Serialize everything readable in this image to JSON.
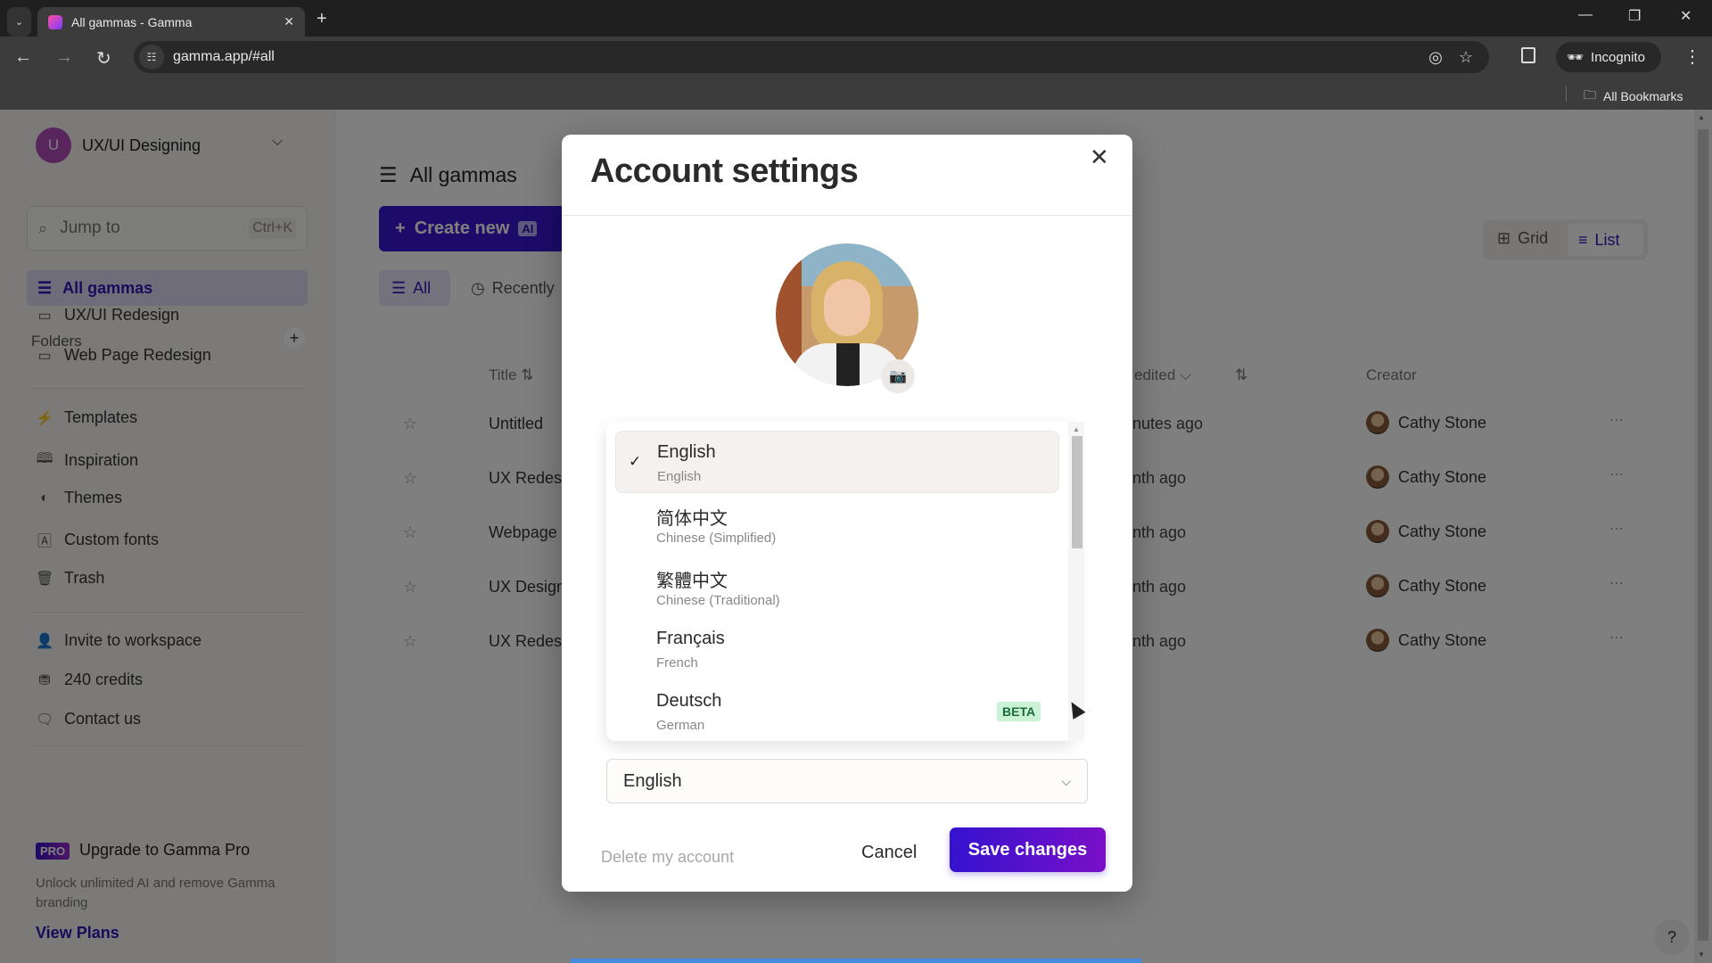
{
  "browser": {
    "tab_title": "All gammas - Gamma",
    "url": "gamma.app/#all",
    "incognito_label": "Incognito",
    "bookmarks_label": "All Bookmarks"
  },
  "sidebar": {
    "workspace_initial": "U",
    "workspace_name": "UX/UI Designing",
    "search_placeholder": "Jump to",
    "search_shortcut": "Ctrl+K",
    "active_item": "All gammas",
    "folders_heading": "Folders",
    "folders": [
      {
        "label": "UX/UI Redesign",
        "icon": "folder-icon"
      },
      {
        "label": "Web Page Redesign",
        "icon": "folder-icon"
      }
    ],
    "items": [
      {
        "label": "Templates",
        "icon": "bolt-icon"
      },
      {
        "label": "Inspiration",
        "icon": "book-icon"
      },
      {
        "label": "Themes",
        "icon": "palette-icon"
      },
      {
        "label": "Custom fonts",
        "icon": "font-icon"
      },
      {
        "label": "Trash",
        "icon": "trash-icon"
      }
    ],
    "bottom_items": [
      {
        "label": "Invite to workspace",
        "icon": "user-plus-icon"
      },
      {
        "label": "240 credits",
        "icon": "coins-icon"
      },
      {
        "label": "Contact us",
        "icon": "chat-icon"
      }
    ],
    "pro": {
      "badge": "PRO",
      "title": "Upgrade to Gamma Pro",
      "description": "Unlock unlimited AI and remove Gamma branding",
      "link": "View Plans"
    }
  },
  "main": {
    "title": "All gammas",
    "create_label": "Create new",
    "create_badge": "AI",
    "filters": [
      "All",
      "Recently"
    ],
    "view_toggle": {
      "grid": "Grid",
      "list": "List",
      "selected": "List"
    },
    "columns": {
      "title": "Title",
      "edited": "edited",
      "creator": "Creator"
    },
    "rows": [
      {
        "title": "Untitled",
        "edited": "nutes ago",
        "creator": "Cathy Stone"
      },
      {
        "title": "UX Redes",
        "edited": "nth ago",
        "creator": "Cathy Stone"
      },
      {
        "title": "Webpage",
        "edited": "nth ago",
        "creator": "Cathy Stone"
      },
      {
        "title": "UX Design",
        "edited": "nth ago",
        "creator": "Cathy Stone"
      },
      {
        "title": "UX Redes",
        "edited": "nth ago",
        "creator": "Cathy Stone"
      }
    ]
  },
  "modal": {
    "title": "Account settings",
    "languages": [
      {
        "native": "English",
        "english": "English",
        "selected": true
      },
      {
        "native": "简体中文",
        "english": "Chinese (Simplified)"
      },
      {
        "native": "繁體中文",
        "english": "Chinese (Traditional)"
      },
      {
        "native": "Français",
        "english": "French"
      },
      {
        "native": "Deutsch",
        "english": "German",
        "badge": "BETA"
      }
    ],
    "language_value": "English",
    "delete_label": "Delete my account",
    "cancel_label": "Cancel",
    "save_label": "Save changes"
  },
  "help_label": "?"
}
